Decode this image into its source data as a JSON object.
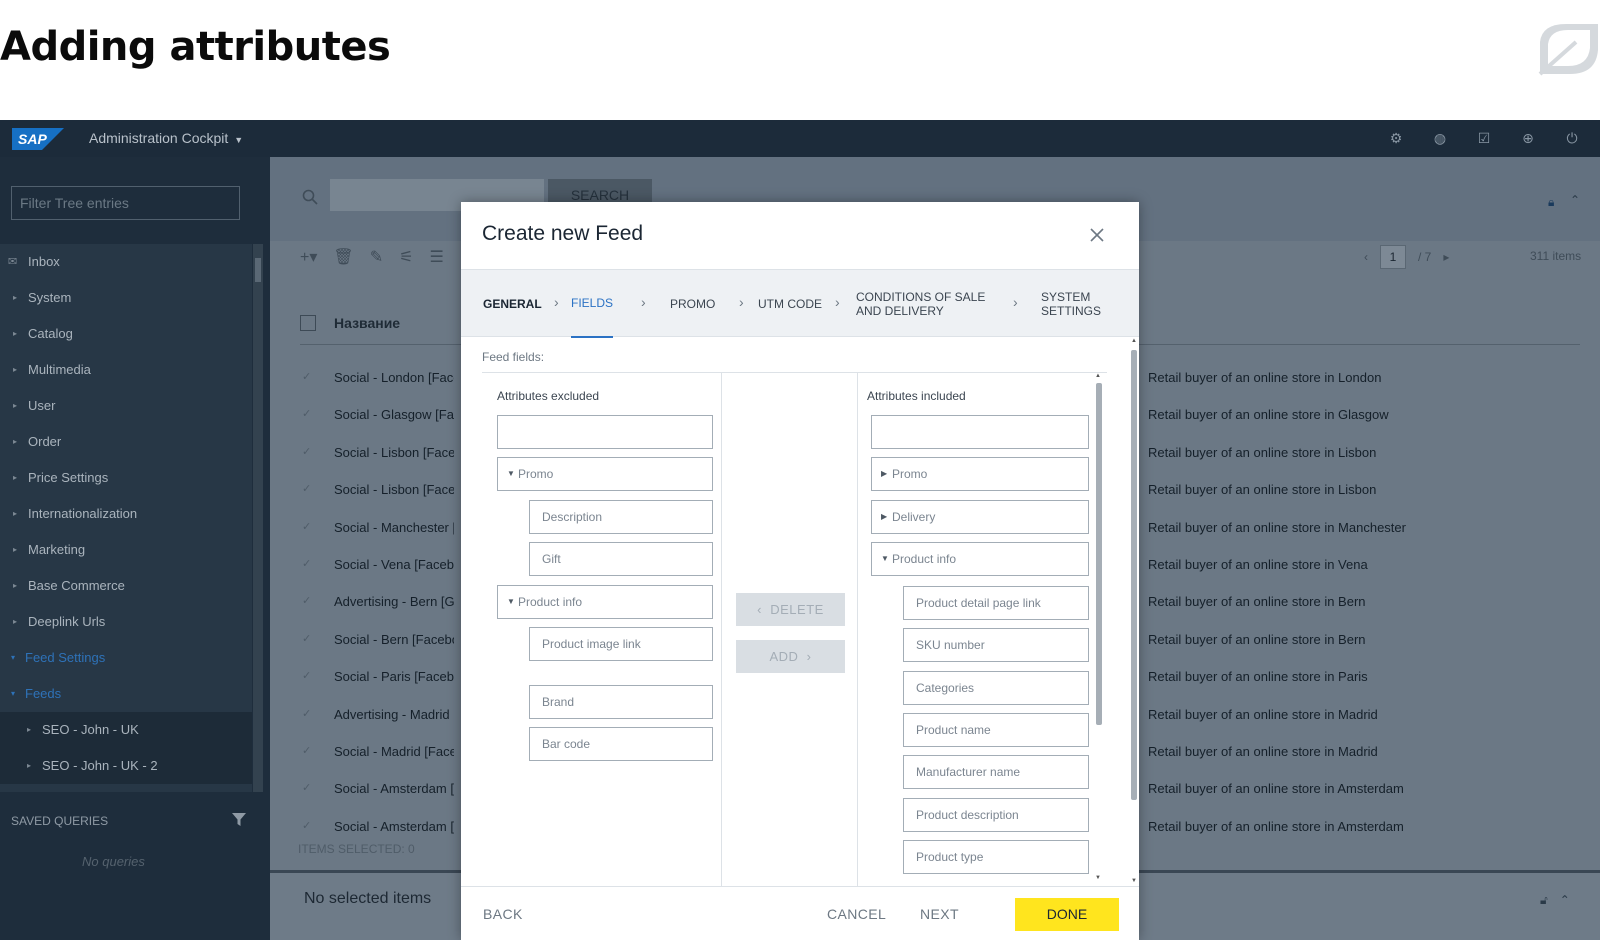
{
  "slide": {
    "title": "Adding attributes"
  },
  "shell": {
    "logo": "SAP",
    "app_name": "Administration Cockpit",
    "icons": [
      "people-settings-icon",
      "globe-icon",
      "checkbox-icon",
      "world-icon",
      "power-icon"
    ]
  },
  "sidebar": {
    "filter_placeholder": "Filter Tree entries",
    "items": [
      {
        "label": "Inbox"
      },
      {
        "label": "System"
      },
      {
        "label": "Catalog"
      },
      {
        "label": "Multimedia"
      },
      {
        "label": "User"
      },
      {
        "label": "Order"
      },
      {
        "label": "Price Settings"
      },
      {
        "label": "Internationalization"
      },
      {
        "label": "Marketing"
      },
      {
        "label": "Base Commerce"
      },
      {
        "label": "Deeplink Urls"
      },
      {
        "label": "Feed Settings"
      },
      {
        "label": "Feeds"
      },
      {
        "label": "SEO - John - UK"
      },
      {
        "label": "SEO - John - UK - 2"
      }
    ],
    "saved_queries_label": "SAVED QUERIES",
    "no_queries": "No queries"
  },
  "main": {
    "search_button": "SEARCH",
    "pager": {
      "current": "1",
      "total": "/ 7"
    },
    "items_count": "311 items",
    "column_title": "Название",
    "rows": [
      {
        "name": "Social - London [Facebook]",
        "desc": "Retail buyer of an online store in London"
      },
      {
        "name": "Social - Glasgow [Facebook]",
        "desc": "Retail buyer of an online store in Glasgow"
      },
      {
        "name": "Social - Lisbon [Facebook]",
        "desc": "Retail buyer of an online store in Lisbon"
      },
      {
        "name": "Social - Lisbon [Facebook]",
        "desc": "Retail buyer of an online store in Lisbon"
      },
      {
        "name": "Social - Manchester [Facebook]",
        "desc": "Retail buyer of an online store in Manchester"
      },
      {
        "name": "Social - Vena [Facebook]",
        "desc": "Retail buyer of an online store in Vena"
      },
      {
        "name": "Advertising - Bern [Google]",
        "desc": "Retail buyer of an online store in Bern"
      },
      {
        "name": "Social -  Bern [Facebook]",
        "desc": "Retail buyer of an online store in Bern"
      },
      {
        "name": "Social - Paris [Facebook]",
        "desc": "Retail buyer of an online store in Paris"
      },
      {
        "name": "Advertising -  Madrid [Google]",
        "desc": "Retail buyer of an online store in Madrid"
      },
      {
        "name": "Social - Madrid [Facebook]",
        "desc": "Retail buyer of an online store in Madrid"
      },
      {
        "name": "Social - Amsterdam [Facebook]",
        "desc": "Retail buyer of an online store in Amsterdam"
      },
      {
        "name": "Social - Amsterdam [Facebook]",
        "desc": "Retail buyer of an online store in Amsterdam"
      }
    ],
    "items_selected": "ITEMS SELECTED: 0",
    "no_selected": "No selected items"
  },
  "modal": {
    "title": "Create new Feed",
    "steps": [
      {
        "label": "GENERAL"
      },
      {
        "label": "FIELDS"
      },
      {
        "label": "PROMO"
      },
      {
        "label": "UTM CODE"
      },
      {
        "label": "CONDITIONS OF SALE AND DELIVERY"
      },
      {
        "label": "SYSTEM SETTINGS"
      }
    ],
    "feed_fields_label": "Feed fields:",
    "excluded": {
      "title": "Attributes excluded",
      "groups": [
        {
          "label": "Promo",
          "items": [
            "Description",
            "Gift"
          ]
        },
        {
          "label": "Product info",
          "items": [
            "Product image link",
            "Brand",
            "Bar code"
          ]
        }
      ]
    },
    "delete_label": "DELETE",
    "add_label": "ADD",
    "included": {
      "title": "Attributes included",
      "groups": [
        {
          "label": "Promo"
        },
        {
          "label": "Delivery"
        },
        {
          "label": "Product info",
          "items": [
            "Product detail page link",
            "SKU number",
            "Categories",
            "Product name",
            "Manufacturer name",
            "Product description",
            "Product type"
          ]
        }
      ]
    },
    "footer": {
      "back": "BACK",
      "cancel": "CANCEL",
      "next": "NEXT",
      "done": "DONE"
    }
  },
  "colors": {
    "accent": "#2b72c4",
    "done": "#ffe51e",
    "shell": "#1c2b3a"
  }
}
